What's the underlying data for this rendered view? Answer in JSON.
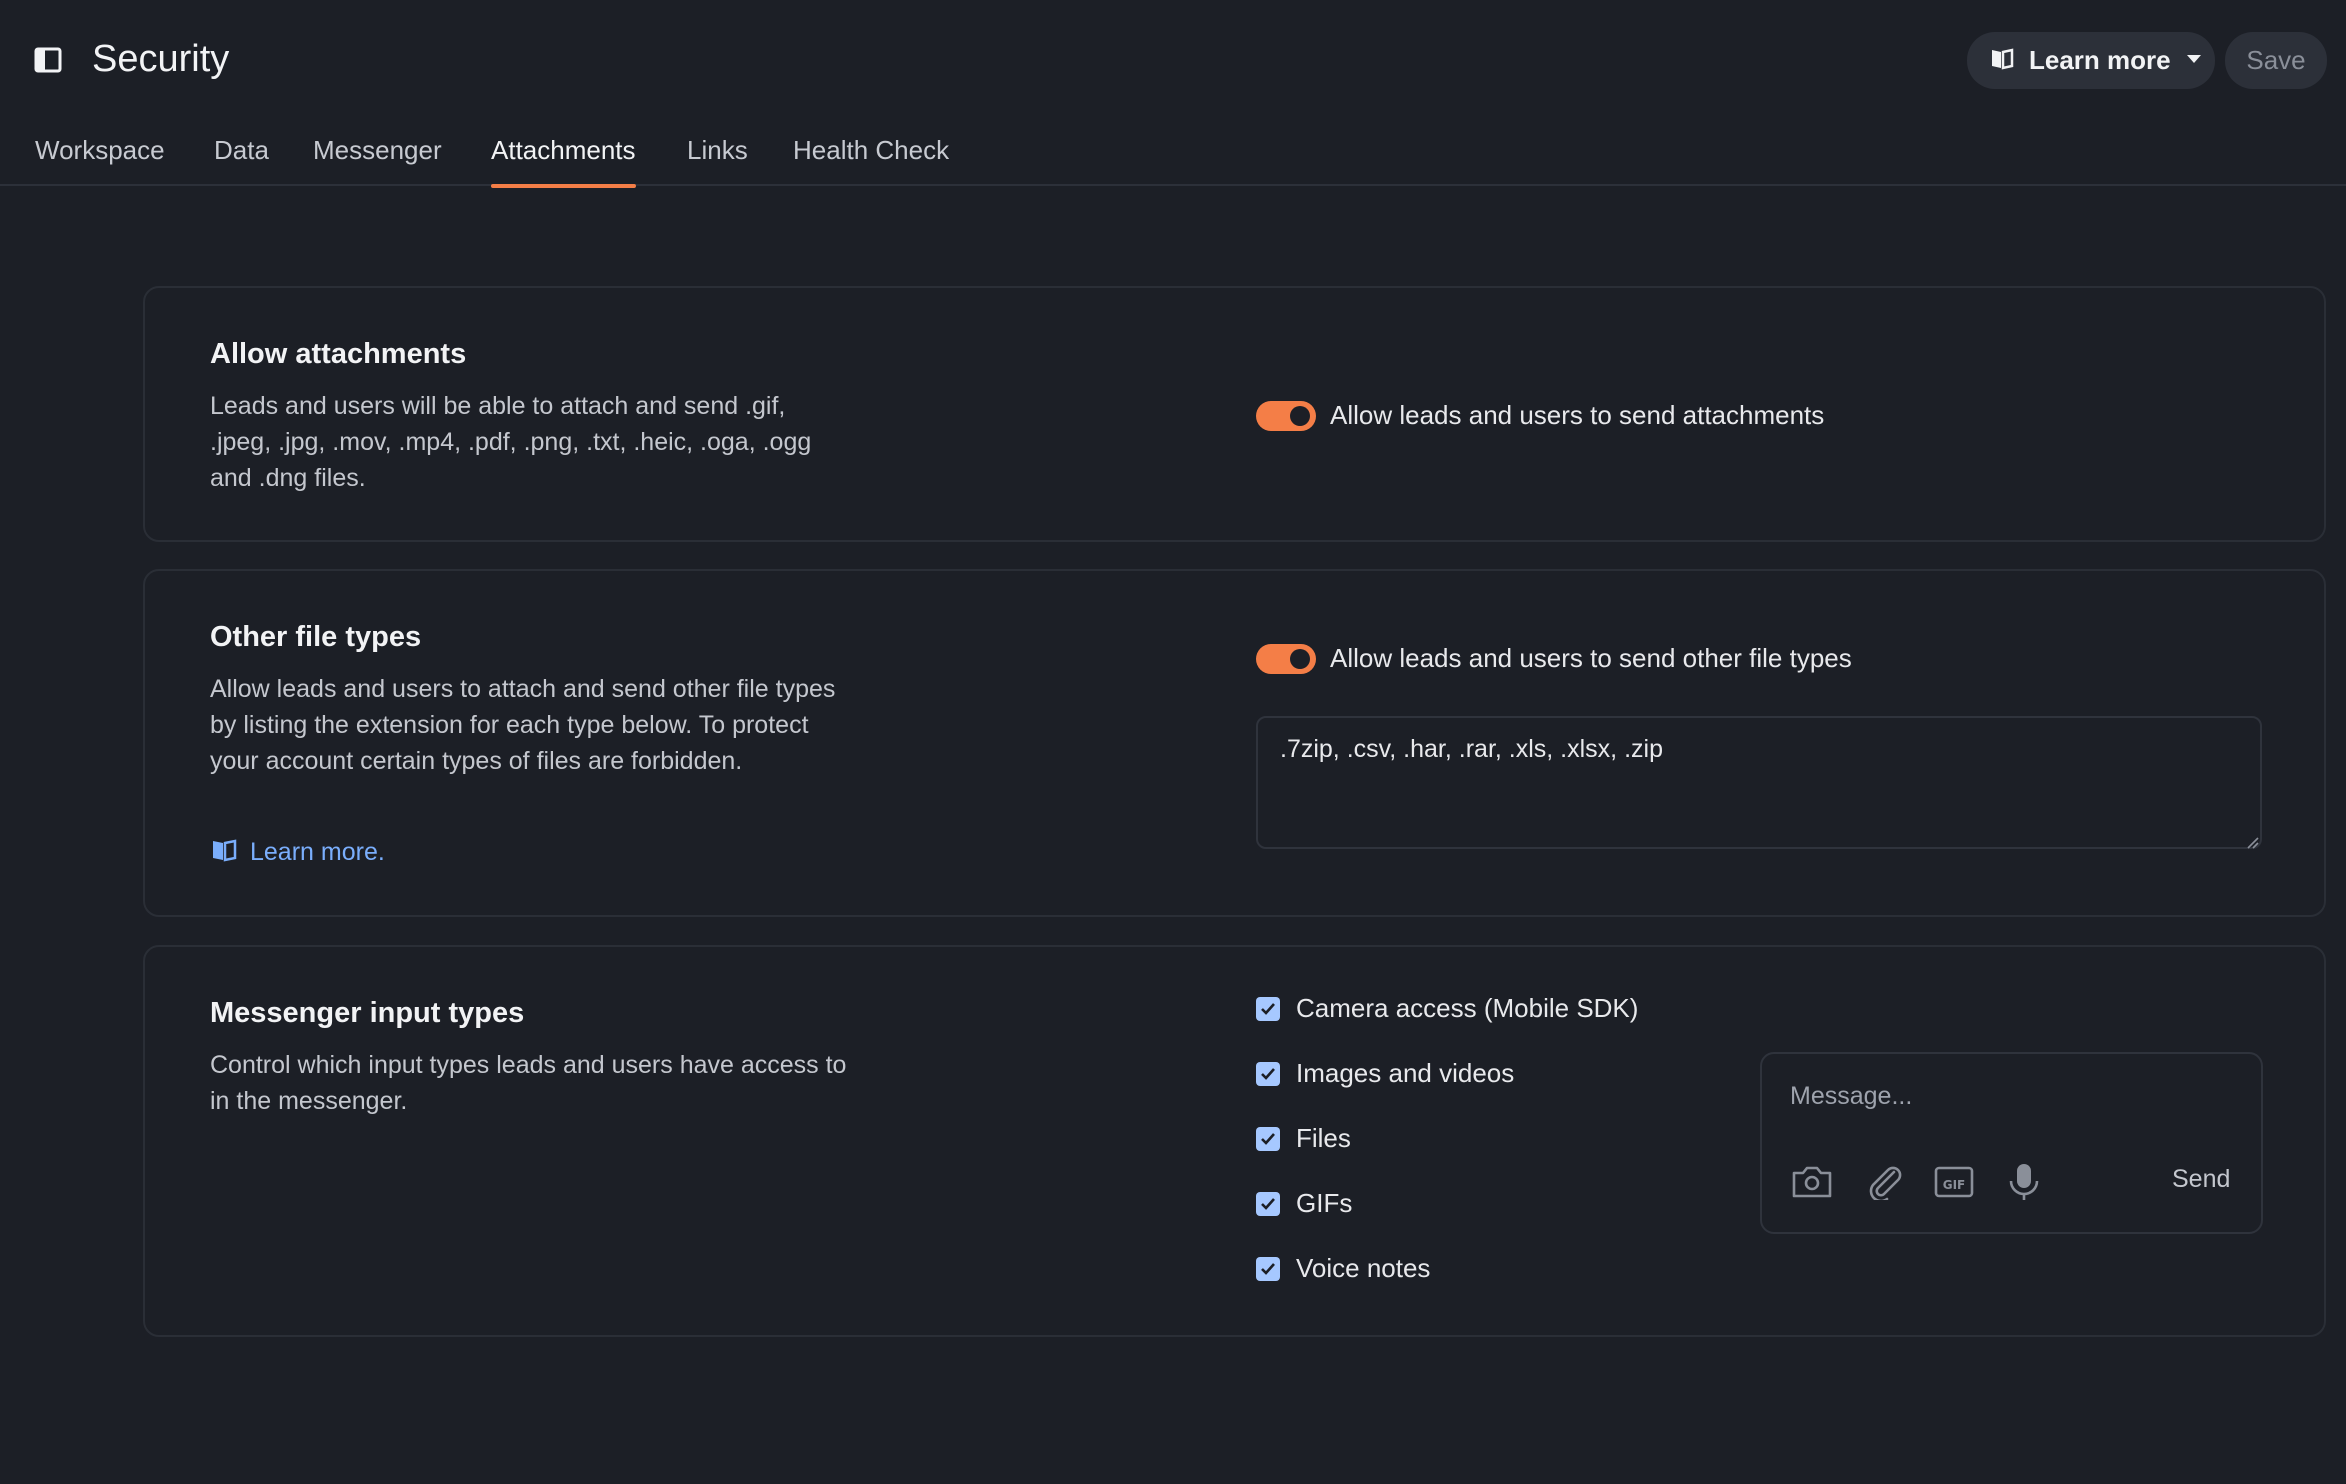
{
  "header": {
    "title": "Security",
    "learn_more_label": "Learn more",
    "save_label": "Save"
  },
  "tabs": [
    {
      "label": "Workspace",
      "active": false
    },
    {
      "label": "Data",
      "active": false
    },
    {
      "label": "Messenger",
      "active": false
    },
    {
      "label": "Attachments",
      "active": true
    },
    {
      "label": "Links",
      "active": false
    },
    {
      "label": "Health Check",
      "active": false
    }
  ],
  "attachments_card": {
    "title": "Allow attachments",
    "description": "Leads and users will be able to attach and send .gif, .jpeg, .jpg, .mov, .mp4, .pdf, .png, .txt, .heic, .oga, .ogg and .dng files.",
    "toggle_label": "Allow leads and users to send attachments",
    "toggle_on": true
  },
  "other_types_card": {
    "title": "Other file types",
    "description": "Allow leads and users to attach and send other file types by listing the extension for each type below. To protect your account certain types of files are forbidden.",
    "learn_link": "Learn more.",
    "toggle_label": "Allow leads and users to send other file types",
    "toggle_on": true,
    "extensions_value": ".7zip, .csv, .har, .rar, .xls, .xlsx, .zip"
  },
  "input_types_card": {
    "title": "Messenger input types",
    "description": "Control which input types leads and users have access to in the messenger.",
    "options": [
      {
        "label": "Camera access (Mobile SDK)",
        "checked": true
      },
      {
        "label": "Images and videos",
        "checked": true
      },
      {
        "label": "Files",
        "checked": true
      },
      {
        "label": "GIFs",
        "checked": true
      },
      {
        "label": "Voice notes",
        "checked": true
      }
    ],
    "preview": {
      "placeholder": "Message...",
      "send_label": "Send",
      "gif_label": "GIF"
    }
  },
  "colors": {
    "accent": "#f47e47",
    "link": "#7aaefc",
    "checkbox": "#a6c8ff",
    "background": "#1c1f26"
  }
}
